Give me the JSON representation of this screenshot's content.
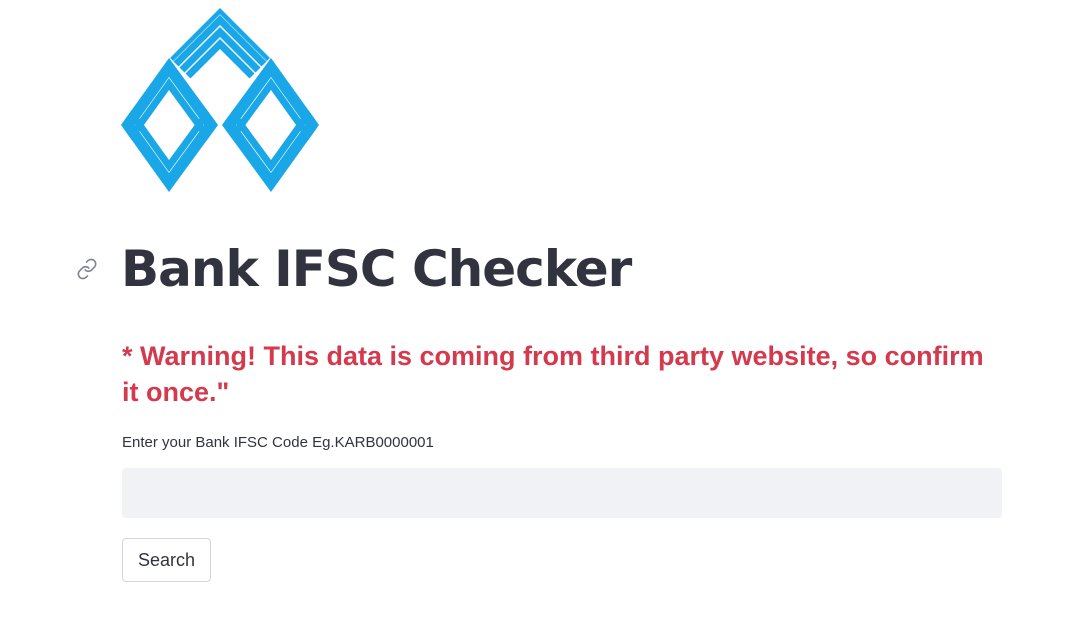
{
  "brand": {
    "logo_icon": "bank-logo-icon",
    "logo_color": "#1aa7e8"
  },
  "header": {
    "anchor_icon": "link-icon",
    "title": "Bank IFSC Checker"
  },
  "main": {
    "warning_text": "* Warning! This data is coming from third party website, so confirm it once.\"",
    "warning_color": "#d33a4e",
    "input": {
      "label": "Enter your Bank IFSC Code Eg.KARB0000001",
      "value": "",
      "placeholder": ""
    },
    "search_button_label": "Search"
  }
}
